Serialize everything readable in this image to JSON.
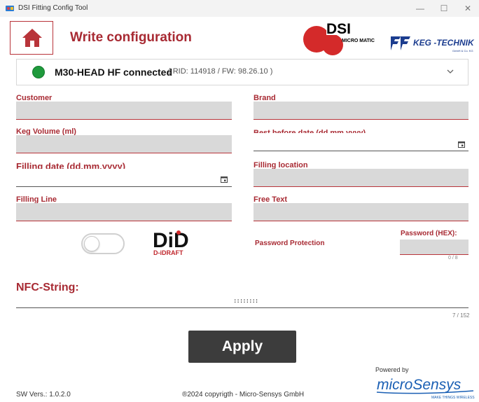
{
  "window": {
    "title": "DSI Fitting Config Tool",
    "minimize": "—",
    "maximize": "☐",
    "close": "✕"
  },
  "header": {
    "page_title": "Write configuration",
    "home_icon": "home-icon",
    "dsi_logo": {
      "main": "DSI",
      "sub": "MICRO MATIC"
    },
    "keg_logo": {
      "main": "KEG -TECHNIK",
      "sub": "GmbH & Co. KG"
    }
  },
  "status": {
    "device": "M30-HEAD HF connected",
    "detail": "( RID: 114918 / FW: 98.26.10 )",
    "indicator_color": "#1f9a3c"
  },
  "fields": {
    "customer": {
      "label": "Customer",
      "value": ""
    },
    "brand": {
      "label": "Brand",
      "value": ""
    },
    "keg_volume": {
      "label": "Keg Volume (ml)",
      "value": ""
    },
    "best_before": {
      "label": "Best before date (dd.mm.yyyy)",
      "value": ""
    },
    "filling_date": {
      "label": "Filling date (dd.mm.yyyy)",
      "value": ""
    },
    "filling_location": {
      "label": "Filling location",
      "value": ""
    },
    "filling_line": {
      "label": "Filling Line",
      "value": ""
    },
    "free_text": {
      "label": "Free Text",
      "value": ""
    }
  },
  "password": {
    "protection_label": "Password Protection",
    "protection_enabled": false,
    "hex_label": "Password (HEX):",
    "value": "",
    "counter": "0 / 8"
  },
  "did_logo": {
    "main": "DiD",
    "sub": "D-iDRAFT"
  },
  "nfc": {
    "label": "NFC-String:",
    "value": "::::::::",
    "counter": "7 / 152"
  },
  "apply_label": "Apply",
  "footer": {
    "version": "SW Vers.: 1.0.2.0",
    "copyright": "®2024 copyrigth - Micro-Sensys GmbH",
    "powered_by": "Powered by",
    "ms_logo": {
      "main": "microSensys",
      "tagline": "MAKE THINGS WIRELESS"
    }
  },
  "colors": {
    "accent": "#a82a33",
    "field_bg": "#d9d9d9",
    "button_dark": "#3c3c3c"
  }
}
